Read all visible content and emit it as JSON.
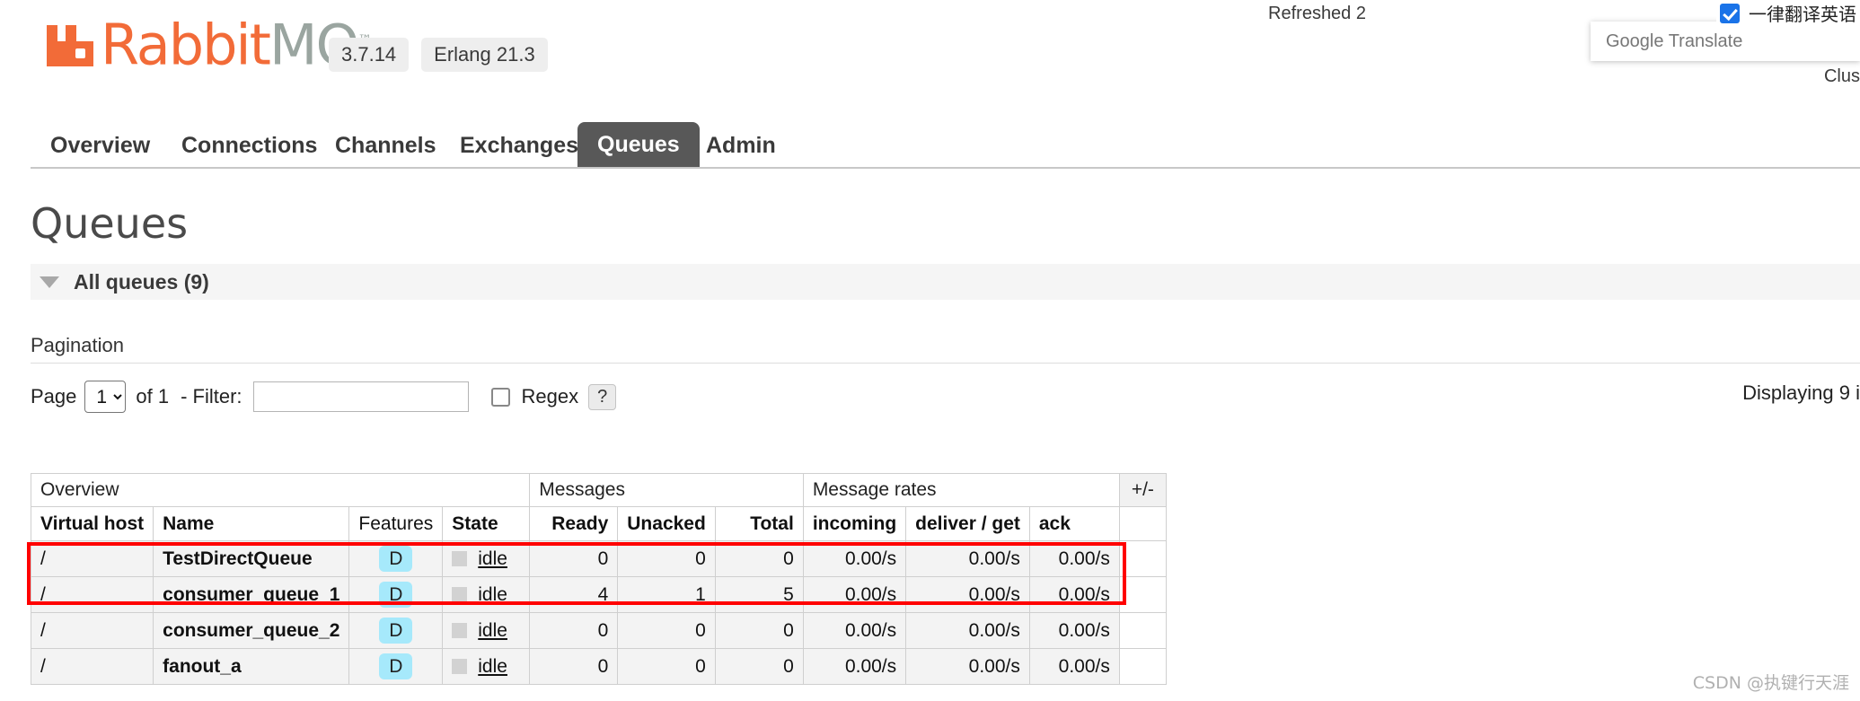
{
  "brand": {
    "name_part1": "Rabbit",
    "name_part2": "MQ",
    "trademark": "™",
    "logo_icon": "rabbitmq-logo-icon",
    "orange": "#f26b38",
    "gray": "#9aa5a0"
  },
  "header": {
    "version_pill": "3.7.14",
    "erlang_pill": "Erlang 21.3",
    "refreshed": "Refreshed 2",
    "cluster": "Clus"
  },
  "translate_widget": {
    "title": "Google Translate",
    "checkbox_label": "一律翻译英语",
    "checked": true
  },
  "nav": {
    "tabs": [
      {
        "label": "Overview",
        "active": false
      },
      {
        "label": "Connections",
        "active": false
      },
      {
        "label": "Channels",
        "active": false
      },
      {
        "label": "Exchanges",
        "active": false
      },
      {
        "label": "Queues",
        "active": true
      },
      {
        "label": "Admin",
        "active": false
      }
    ],
    "active_bg": "#585858"
  },
  "page": {
    "title": "Queues",
    "section_label": "All queues (9)",
    "collapse_icon": "chevron-down-triangle-icon"
  },
  "pagination": {
    "label": "Pagination",
    "page_word": "Page",
    "page_value": "1",
    "page_options": [
      "1"
    ],
    "of_text": "of 1",
    "filter_dash": "- Filter:",
    "filter_value": "",
    "filter_placeholder": "",
    "regex_label": "Regex",
    "regex_checked": false,
    "help_label": "?",
    "displaying": "Displaying 9 i"
  },
  "table": {
    "group_headers": [
      {
        "label": "Overview",
        "span": 4
      },
      {
        "label": "Messages",
        "span": 3
      },
      {
        "label": "Message rates",
        "span": 3
      },
      {
        "label": "+/-",
        "span": 1
      }
    ],
    "columns": [
      {
        "label": "Virtual host",
        "bold": true,
        "align": "left"
      },
      {
        "label": "Name",
        "bold": true,
        "align": "left"
      },
      {
        "label": "Features",
        "bold": false,
        "align": "left"
      },
      {
        "label": "State",
        "bold": true,
        "align": "left"
      },
      {
        "label": "Ready",
        "bold": true,
        "align": "right"
      },
      {
        "label": "Unacked",
        "bold": true,
        "align": "right"
      },
      {
        "label": "Total",
        "bold": true,
        "align": "right"
      },
      {
        "label": "incoming",
        "bold": true,
        "align": "left"
      },
      {
        "label": "deliver / get",
        "bold": true,
        "align": "left"
      },
      {
        "label": "ack",
        "bold": true,
        "align": "left"
      }
    ],
    "rows": [
      {
        "vhost": "/",
        "name": "TestDirectQueue",
        "feature": "D",
        "state": "idle",
        "ready": "0",
        "unacked": "0",
        "total": "0",
        "incoming": "0.00/s",
        "deliver_get": "0.00/s",
        "ack": "0.00/s",
        "highlighted": false
      },
      {
        "vhost": "/",
        "name": "consumer_queue_1",
        "feature": "D",
        "state": "idle",
        "ready": "4",
        "unacked": "1",
        "total": "5",
        "incoming": "0.00/s",
        "deliver_get": "0.00/s",
        "ack": "0.00/s",
        "highlighted": true
      },
      {
        "vhost": "/",
        "name": "consumer_queue_2",
        "feature": "D",
        "state": "idle",
        "ready": "0",
        "unacked": "0",
        "total": "0",
        "incoming": "0.00/s",
        "deliver_get": "0.00/s",
        "ack": "0.00/s",
        "highlighted": true
      },
      {
        "vhost": "/",
        "name": "fanout_a",
        "feature": "D",
        "state": "idle",
        "ready": "0",
        "unacked": "0",
        "total": "0",
        "incoming": "0.00/s",
        "deliver_get": "0.00/s",
        "ack": "0.00/s",
        "highlighted": false
      }
    ],
    "badge_color": "#a6e9fb",
    "highlight_color": "#ff0000"
  },
  "watermark": "CSDN @执键行天涯"
}
